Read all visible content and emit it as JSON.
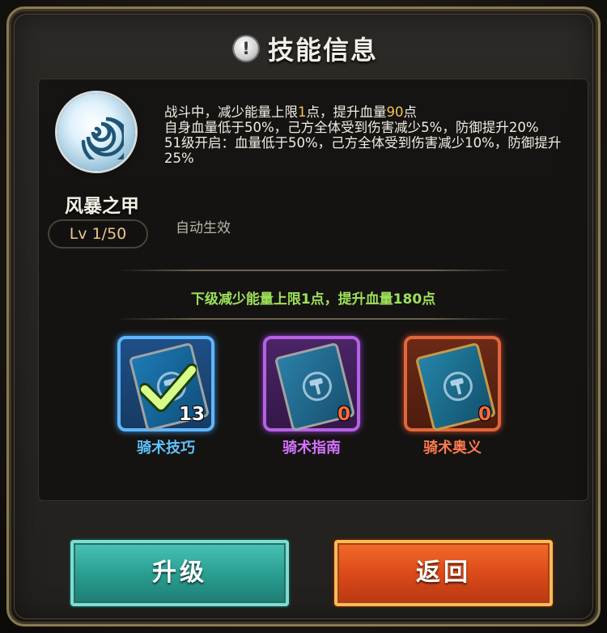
{
  "header": {
    "title": "技能信息",
    "icon": "alert-icon"
  },
  "skill": {
    "name": "风暴之甲",
    "level": "Lv 1/50",
    "icon": "swirl-icon",
    "description": {
      "line1_pre": "战斗中，减少能量上限",
      "line1_energy": "1",
      "line1_mid": "点，提升血量",
      "line1_hp": "90",
      "line1_post": "点",
      "line2": "自身血量低于50%，己方全体受到伤害减少5%，防御提升20%",
      "line3": "51级开启：血量低于50%，己方全体受到伤害减少10%，防御提升25%"
    },
    "trigger": "自动生效",
    "next_level": "下级减少能量上限1点，提升血量180点"
  },
  "items": [
    {
      "name": "骑术技巧",
      "count": "13",
      "icon": "book-icon"
    },
    {
      "name": "骑术指南",
      "count": "0",
      "icon": "book-icon"
    },
    {
      "name": "骑术奥义",
      "count": "0",
      "icon": "book-icon"
    }
  ],
  "buttons": {
    "upgrade": "升级",
    "back": "返回"
  },
  "colors": {
    "accent_green": "#9ee05a",
    "highlight": "#f5c54c",
    "upgrade": "#2a9f92",
    "back": "#dc4a1a"
  }
}
